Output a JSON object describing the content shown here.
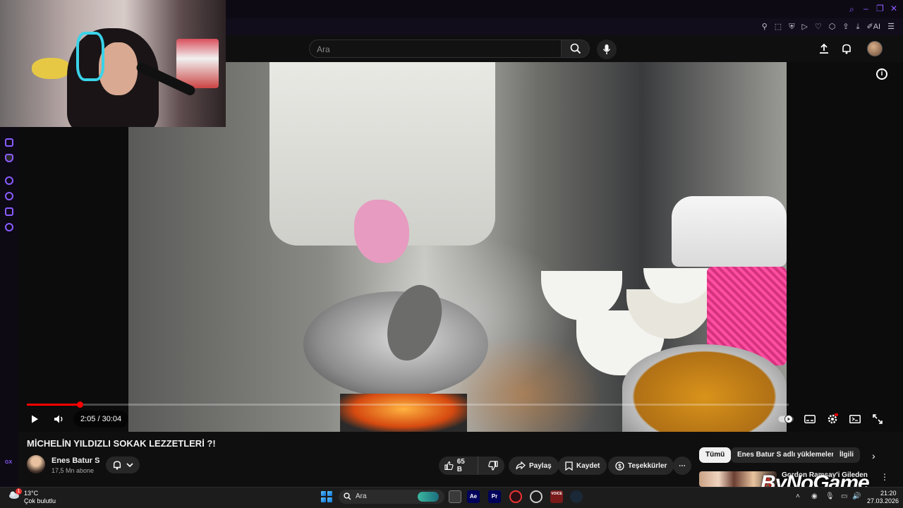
{
  "browser": {
    "toolbar_icons": [
      "pin-icon",
      "screenshot-icon",
      "shield-icon",
      "play-icon",
      "heart-icon",
      "extensions-icon",
      "share-icon",
      "download-icon",
      "aria-icon",
      "menu-icon"
    ],
    "ai_label": "AI"
  },
  "youtube": {
    "search": {
      "placeholder": "Ara"
    }
  },
  "player": {
    "current_time": "2:05",
    "total_time": "30:04",
    "time_display": "2:05 / 30:04",
    "progress_fraction": 0.0693,
    "accent": "#ff0000"
  },
  "video": {
    "title": "MİCHELİN YILDIZLI SOKAK LEZZETLERİ ?!",
    "channel": {
      "name": "Enes Batur S",
      "subscribers": "17,5 Mn abone"
    },
    "actions": {
      "likes": "65 B",
      "share": "Paylaş",
      "save": "Kaydet",
      "thanks": "Teşekkürler"
    }
  },
  "recommendations": {
    "chips": [
      "Tümü",
      "Enes Batur S adlı yüklemelerden",
      "İlgili"
    ],
    "first_title": "Gordon Ramsay'i Gileden"
  },
  "watermark": "ByNoGame",
  "taskbar": {
    "weather_temp": "13°C",
    "weather_desc": "Çok bulutlu",
    "weather_badge": "1",
    "search_placeholder": "Ara",
    "apps": [
      {
        "name": "after-effects",
        "label": "Ae",
        "color": "#00005b"
      },
      {
        "name": "premiere",
        "label": "Pr",
        "color": "#00005b"
      },
      {
        "name": "opera-gx",
        "label": "",
        "color": "#2a0f14"
      },
      {
        "name": "discord",
        "label": "",
        "color": "#2b2b2b"
      },
      {
        "name": "voicemeeter",
        "label": "VOICE",
        "color": "#7a1a1a"
      },
      {
        "name": "steam",
        "label": "",
        "color": "#1b2838"
      }
    ],
    "time": "21:20",
    "date": "27.03.2026"
  }
}
